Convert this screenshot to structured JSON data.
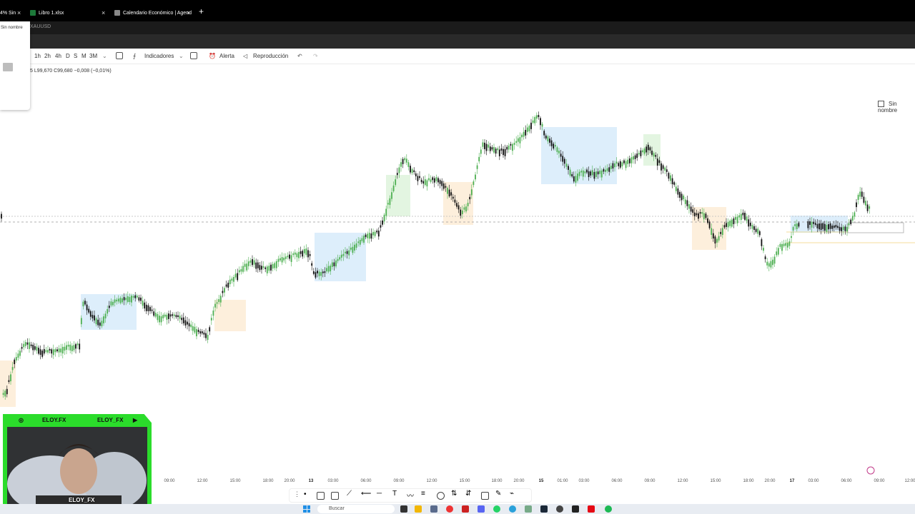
{
  "tabs": [
    {
      "label": "4% Sin",
      "favicon_color": "#3fa34d"
    },
    {
      "label": "Libro 1.xlsx",
      "favicon_color": "#1d7a3a"
    },
    {
      "label": "Calendario Económico | Agend",
      "favicon_color": "#888888"
    }
  ],
  "new_tab": "+",
  "close_glyph": "×",
  "symbol": "XAUUSD",
  "popup": {
    "title": "Sin nombre"
  },
  "timeframes": [
    "1h",
    "2h",
    "4h",
    "D",
    "S",
    "M",
    "3M"
  ],
  "toolbar": {
    "indicators": "Indicadores",
    "alert": "Alerta",
    "replay": "Reproducción",
    "layout_name": "Sin nombre"
  },
  "ohlc_text": "5  L99,670  C99,680  −0,008 (−0,01%)",
  "time_ticks": [
    {
      "label": "09:00",
      "bold": false
    },
    {
      "label": "12:00",
      "bold": false
    },
    {
      "label": "15:00",
      "bold": false
    },
    {
      "label": "18:00",
      "bold": false
    },
    {
      "label": "20:00",
      "bold": false
    },
    {
      "label": "13",
      "bold": true
    },
    {
      "label": "03:00",
      "bold": false
    },
    {
      "label": "06:00",
      "bold": false
    },
    {
      "label": "09:00",
      "bold": false
    },
    {
      "label": "12:00",
      "bold": false
    },
    {
      "label": "15:00",
      "bold": false
    },
    {
      "label": "18:00",
      "bold": false
    },
    {
      "label": "20:00",
      "bold": false
    },
    {
      "label": "15",
      "bold": true
    },
    {
      "label": "01:00",
      "bold": false
    },
    {
      "label": "03:00",
      "bold": false
    },
    {
      "label": "06:00",
      "bold": false
    },
    {
      "label": "09:00",
      "bold": false
    },
    {
      "label": "12:00",
      "bold": false
    },
    {
      "label": "15:00",
      "bold": false
    },
    {
      "label": "18:00",
      "bold": false
    },
    {
      "label": "20:00",
      "bold": false
    },
    {
      "label": "17",
      "bold": true
    },
    {
      "label": "03:00",
      "bold": false
    },
    {
      "label": "06:00",
      "bold": false
    },
    {
      "label": "09:00",
      "bold": false
    },
    {
      "label": "12:00",
      "bold": false
    }
  ],
  "taskbar": {
    "search_placeholder": "Buscar"
  },
  "webcam": {
    "handle_left": "ELOY.FX",
    "handle_right": "ELOY_FX",
    "name": "ELOY_FX"
  },
  "colors": {
    "up": "#4caf50",
    "down": "#111111",
    "box_blue": "#ddeefb",
    "box_orange": "#fdefdc",
    "box_green": "#e3f5e1",
    "cam_frame": "#2bdc2b"
  }
}
